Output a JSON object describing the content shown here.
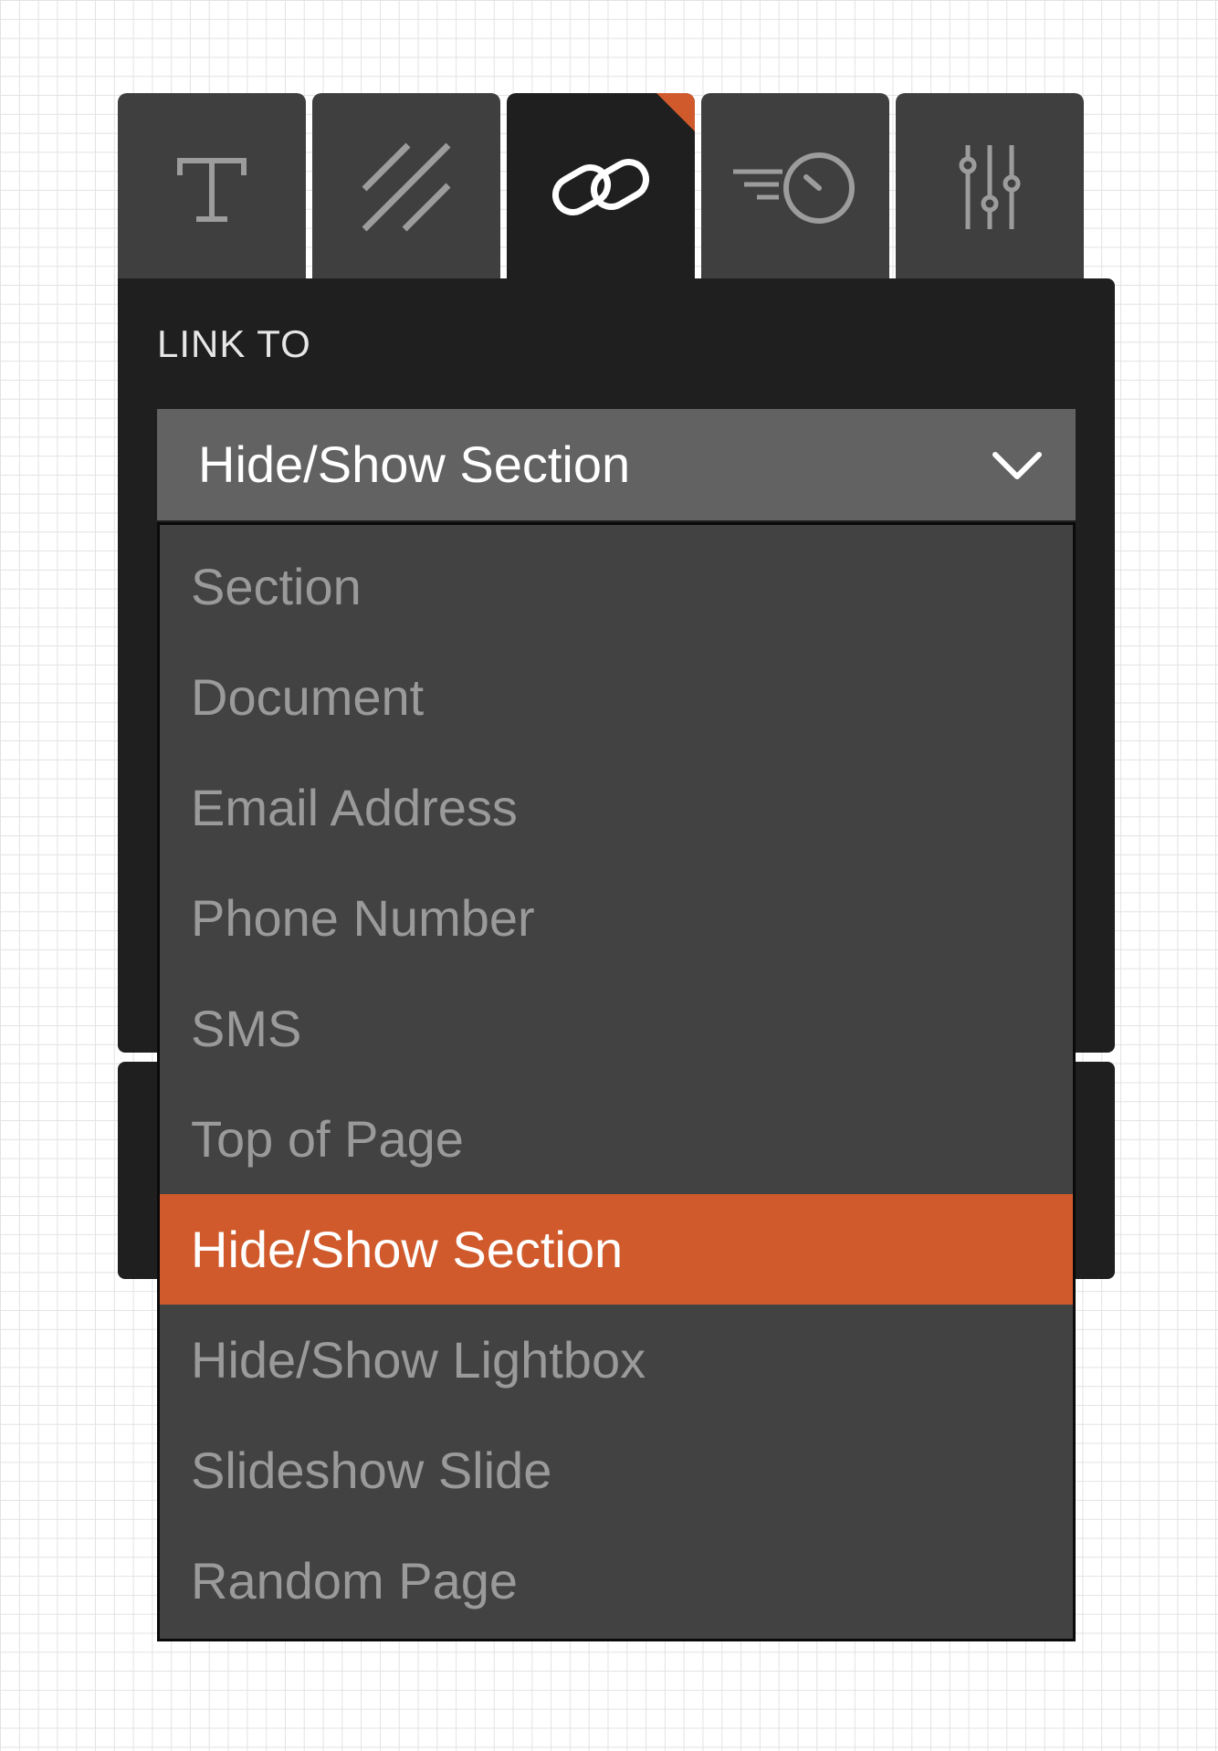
{
  "tabs": [
    {
      "icon": "text-icon",
      "active": false
    },
    {
      "icon": "diagonal-lines-icon",
      "active": false
    },
    {
      "icon": "link-icon",
      "active": true
    },
    {
      "icon": "timer-icon",
      "active": false
    },
    {
      "icon": "sliders-icon",
      "active": false
    }
  ],
  "panel": {
    "label": "LINK TO",
    "selected_value": "Hide/Show Section"
  },
  "dropdown": {
    "options": [
      "Section",
      "Document",
      "Email Address",
      "Phone Number",
      "SMS",
      "Top of Page",
      "Hide/Show Section",
      "Hide/Show Lightbox",
      "Slideshow Slide",
      "Random Page"
    ],
    "selected_index": 6
  },
  "colors": {
    "accent": "#d05a2c",
    "panel_bg": "#1f1f1f",
    "tab_bg": "#3f3f3f",
    "select_bg": "#626262",
    "dropdown_bg": "#424242"
  }
}
